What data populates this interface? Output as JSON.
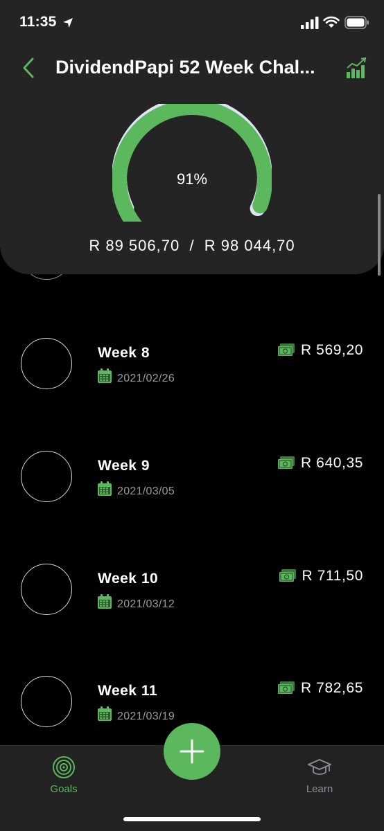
{
  "status": {
    "time": "11:35"
  },
  "header": {
    "title": "DividendPapi 52 Week Chal..."
  },
  "progress": {
    "percent_label": "91%",
    "fraction": 0.91,
    "amounts_label": "R 89 506,70  /  R 98 044,70",
    "current": "R 89 506,70",
    "target": "R 98 044,70"
  },
  "weeks": [
    {
      "title": "Week 8",
      "date": "2021/02/26",
      "amount": "R 569,20"
    },
    {
      "title": "Week 9",
      "date": "2021/03/05",
      "amount": "R 640,35"
    },
    {
      "title": "Week 10",
      "date": "2021/03/12",
      "amount": "R 711,50"
    },
    {
      "title": "Week 11",
      "date": "2021/03/19",
      "amount": "R 782,65"
    }
  ],
  "tabs": {
    "goals": "Goals",
    "learn": "Learn"
  },
  "colors": {
    "accent": "#5cb85c",
    "gauge_remaining": "#dfe4f5",
    "panel": "#242424",
    "background": "#000000"
  },
  "icons": {
    "back": "chevron-left-icon",
    "stats": "bar-chart-trend-icon",
    "calendar": "calendar-icon",
    "money": "money-bill-icon",
    "goals": "target-icon",
    "learn": "graduation-cap-icon",
    "add": "plus-icon"
  }
}
